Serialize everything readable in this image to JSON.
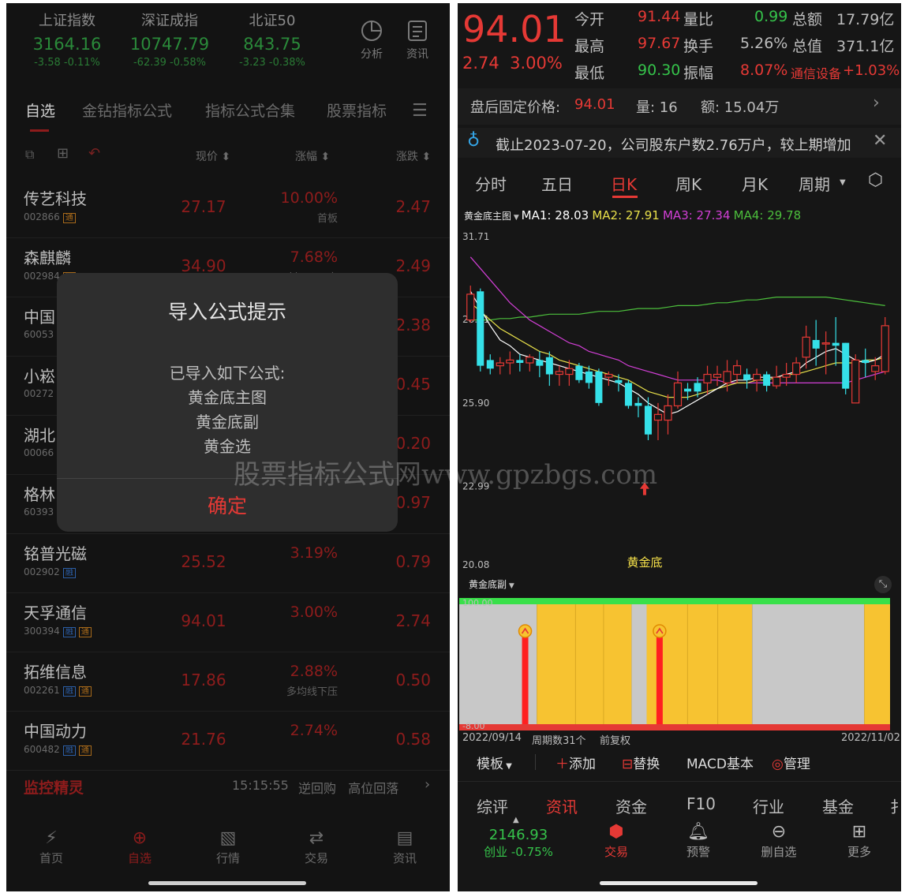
{
  "left": {
    "indices": [
      {
        "name": "上证指数",
        "value": "3164.16",
        "change": "-3.58  -0.11%"
      },
      {
        "name": "深证成指",
        "value": "10747.79",
        "change": "-62.39  -0.58%"
      },
      {
        "name": "北证50",
        "value": "843.75",
        "change": "-3.23  -0.38%"
      }
    ],
    "top_tools": [
      {
        "label": "分析",
        "icon": "pie-icon"
      },
      {
        "label": "资讯",
        "icon": "news-icon"
      }
    ],
    "tabs": [
      "自选",
      "金钻指标公式",
      "指标公式合集",
      "股票指标"
    ],
    "columns": {
      "price": "现价 ⬍",
      "pct": "涨幅 ⬍",
      "delta": "涨跌 ⬍"
    },
    "rows": [
      {
        "name": "传艺科技",
        "code": "002866",
        "badges": [
          "通"
        ],
        "price": "27.17",
        "pct": "10.00%",
        "tag": "首板",
        "delta": "2.47"
      },
      {
        "name": "森麒麟",
        "code": "002984",
        "badges": [
          "通"
        ],
        "price": "34.90",
        "pct": "7.68%",
        "tag": "创120天高",
        "delta": "2.49"
      },
      {
        "name": "中国",
        "code": "60053",
        "badges": [],
        "price": "",
        "pct": "",
        "tag": "",
        "delta": "2.38"
      },
      {
        "name": "小崧",
        "code": "00272",
        "badges": [],
        "price": "",
        "pct": "",
        "tag": "",
        "delta": "0.45"
      },
      {
        "name": "湖北",
        "code": "00066",
        "badges": [],
        "price": "",
        "pct": "",
        "tag": "",
        "delta": "0.20"
      },
      {
        "name": "格林",
        "code": "60393",
        "badges": [],
        "price": "",
        "pct": "",
        "tag": "",
        "delta": "0.97"
      },
      {
        "name": "铭普光磁",
        "code": "002902",
        "badges": [
          "融"
        ],
        "price": "25.52",
        "pct": "3.19%",
        "tag": "",
        "delta": "0.79"
      },
      {
        "name": "天孚通信",
        "code": "300394",
        "badges": [
          "融",
          "通"
        ],
        "price": "94.01",
        "pct": "3.00%",
        "tag": "",
        "delta": "2.74"
      },
      {
        "name": "拓维信息",
        "code": "002261",
        "badges": [
          "融",
          "通"
        ],
        "price": "17.86",
        "pct": "2.88%",
        "tag": "多均线下压",
        "delta": "0.50"
      },
      {
        "name": "中国动力",
        "code": "600482",
        "badges": [
          "融",
          "通"
        ],
        "price": "21.76",
        "pct": "2.74%",
        "tag": "",
        "delta": "0.58"
      }
    ],
    "dialog": {
      "title": "导入公式提示",
      "body": [
        "已导入如下公式:",
        "黄金底主图",
        "黄金底副",
        "黄金选"
      ],
      "ok": "确定"
    },
    "monitor": {
      "title": "监控精灵",
      "time": "15:15:55",
      "items": "逆回购   高位回落"
    },
    "bottom_nav": [
      {
        "label": "首页",
        "icon": "home-icon"
      },
      {
        "label": "自选",
        "icon": "watchlist-icon"
      },
      {
        "label": "行情",
        "icon": "market-icon"
      },
      {
        "label": "交易",
        "icon": "trade-icon"
      },
      {
        "label": "资讯",
        "icon": "news-icon"
      }
    ]
  },
  "right": {
    "price": "94.01",
    "change": "2.74  3.00%",
    "quote": {
      "today_open_label": "今开",
      "today_open": "91.44",
      "high_label": "最高",
      "high": "97.67",
      "low_label": "最低",
      "low": "90.30",
      "vol_ratio_label": "量比",
      "vol_ratio": "0.99",
      "turnover_label": "换手",
      "turnover": "5.26%",
      "amplitude_label": "振幅",
      "amplitude": "8.07%",
      "amount_label": "总额",
      "amount": "17.79亿",
      "mktcap_label": "总值",
      "mktcap": "371.1亿",
      "sector": "通信设备",
      "sector_change": "+1.03%"
    },
    "after_hours": {
      "label": "盘后固定价格:",
      "price": "94.01",
      "vol": "量: 16",
      "amt": "额: 15.04万"
    },
    "notice": "截止2023-07-20，公司股东户数2.76万户，较上期增加",
    "period_tabs": [
      "分时",
      "五日",
      "日K",
      "周K",
      "月K",
      "周期"
    ],
    "ma": {
      "indicator": "黄金底主图",
      "ma1": "MA1: 28.03",
      "ma2": "MA2: 27.91",
      "ma3": "MA3: 27.34",
      "ma4": "MA4: 29.78"
    },
    "colors": {
      "up": "#e53935",
      "down": "#35e0e8",
      "ma1": "#ffffff",
      "ma2": "#e8e04a",
      "ma3": "#d23fd6",
      "ma4": "#4cbf3c",
      "gold": "#f7c331"
    },
    "chart_data": {
      "type": "candlestick",
      "y_ticks": [
        "31.71",
        "28.81",
        "25.90",
        "22.99",
        "20.08"
      ],
      "ylim": [
        20.08,
        31.71
      ],
      "annotation": "黄金底",
      "candles": [
        {
          "o": 28.8,
          "c": 29.7,
          "h": 30.0,
          "l": 28.7
        },
        {
          "o": 29.8,
          "c": 27.2,
          "h": 29.9,
          "l": 27.0
        },
        {
          "o": 27.4,
          "c": 27.1,
          "h": 27.6,
          "l": 26.9
        },
        {
          "o": 27.2,
          "c": 27.3,
          "h": 27.5,
          "l": 26.9
        },
        {
          "o": 27.3,
          "c": 27.4,
          "h": 27.7,
          "l": 26.9
        },
        {
          "o": 27.4,
          "c": 27.3,
          "h": 27.6,
          "l": 27.0
        },
        {
          "o": 27.3,
          "c": 27.5,
          "h": 27.6,
          "l": 27.0
        },
        {
          "o": 27.4,
          "c": 27.2,
          "h": 27.7,
          "l": 26.8
        },
        {
          "o": 27.5,
          "c": 26.9,
          "h": 27.7,
          "l": 26.5
        },
        {
          "o": 26.9,
          "c": 27.0,
          "h": 27.2,
          "l": 26.5
        },
        {
          "o": 26.9,
          "c": 27.1,
          "h": 27.4,
          "l": 26.5
        },
        {
          "o": 27.2,
          "c": 26.7,
          "h": 27.3,
          "l": 26.6
        },
        {
          "o": 27.0,
          "c": 26.6,
          "h": 27.2,
          "l": 26.4
        },
        {
          "o": 27.0,
          "c": 25.9,
          "h": 27.1,
          "l": 25.8
        },
        {
          "o": 26.8,
          "c": 26.9,
          "h": 27.0,
          "l": 26.5
        },
        {
          "o": 26.7,
          "c": 26.6,
          "h": 26.9,
          "l": 26.3
        },
        {
          "o": 26.6,
          "c": 25.8,
          "h": 26.7,
          "l": 25.7
        },
        {
          "o": 25.9,
          "c": 25.8,
          "h": 26.1,
          "l": 25.4
        },
        {
          "o": 25.8,
          "c": 24.8,
          "h": 26.1,
          "l": 24.6
        },
        {
          "o": 25.3,
          "c": 25.5,
          "h": 25.9,
          "l": 24.6
        },
        {
          "o": 25.3,
          "c": 25.8,
          "h": 26.2,
          "l": 24.8
        },
        {
          "o": 25.8,
          "c": 26.6,
          "h": 27.0,
          "l": 25.7
        },
        {
          "o": 26.4,
          "c": 26.3,
          "h": 26.6,
          "l": 26.0
        },
        {
          "o": 26.6,
          "c": 26.3,
          "h": 26.8,
          "l": 26.1
        },
        {
          "o": 26.6,
          "c": 26.9,
          "h": 27.2,
          "l": 26.2
        },
        {
          "o": 26.8,
          "c": 26.9,
          "h": 27.2,
          "l": 26.5
        },
        {
          "o": 26.6,
          "c": 27.0,
          "h": 27.4,
          "l": 26.3
        },
        {
          "o": 26.9,
          "c": 27.2,
          "h": 27.4,
          "l": 26.6
        },
        {
          "o": 26.9,
          "c": 26.7,
          "h": 27.1,
          "l": 26.4
        },
        {
          "o": 26.7,
          "c": 26.9,
          "h": 27.1,
          "l": 26.3
        },
        {
          "o": 26.9,
          "c": 26.5,
          "h": 27.0,
          "l": 26.3
        },
        {
          "o": 26.5,
          "c": 26.8,
          "h": 27.2,
          "l": 26.4
        },
        {
          "o": 26.8,
          "c": 26.9,
          "h": 27.3,
          "l": 26.5
        },
        {
          "o": 26.9,
          "c": 27.3,
          "h": 27.5,
          "l": 26.6
        },
        {
          "o": 27.5,
          "c": 28.2,
          "h": 28.6,
          "l": 27.1
        },
        {
          "o": 28.1,
          "c": 27.8,
          "h": 28.8,
          "l": 27.2
        },
        {
          "o": 28.0,
          "c": 28.0,
          "h": 28.4,
          "l": 26.9
        },
        {
          "o": 28.0,
          "c": 27.9,
          "h": 28.9,
          "l": 27.2
        },
        {
          "o": 28.0,
          "c": 26.4,
          "h": 28.0,
          "l": 26.2
        },
        {
          "o": 25.9,
          "c": 27.4,
          "h": 27.6,
          "l": 25.9
        },
        {
          "o": 27.4,
          "c": 27.3,
          "h": 27.8,
          "l": 26.8
        },
        {
          "o": 27.0,
          "c": 27.2,
          "h": 27.5,
          "l": 26.7
        },
        {
          "o": 27.0,
          "c": 28.6,
          "h": 28.9,
          "l": 26.9
        }
      ],
      "ma_lines": {
        "ma1": [
          29.8,
          29.2,
          28.6,
          28.1,
          27.9,
          27.6,
          27.5,
          27.4,
          27.3,
          27.2,
          27.1,
          27.0,
          26.9,
          26.8,
          26.7,
          26.6,
          26.4,
          26.2,
          25.9,
          25.7,
          25.5,
          25.6,
          25.8,
          26.0,
          26.2,
          26.4,
          26.6,
          26.7,
          26.7,
          26.8,
          26.8,
          26.8,
          26.9,
          27.0,
          27.3,
          27.5,
          27.7,
          27.8,
          27.6,
          27.4,
          27.3,
          27.4,
          27.6
        ],
        "ma2": [
          29.4,
          29.1,
          28.8,
          28.5,
          28.3,
          28.1,
          27.9,
          27.7,
          27.6,
          27.4,
          27.3,
          27.2,
          27.1,
          27.0,
          26.9,
          26.8,
          26.7,
          26.5,
          26.3,
          26.2,
          26.1,
          26.1,
          26.1,
          26.2,
          26.3,
          26.4,
          26.5,
          26.6,
          26.6,
          26.7,
          26.7,
          26.8,
          26.9,
          26.9,
          27.0,
          27.1,
          27.2,
          27.3,
          27.3,
          27.3,
          27.4,
          27.4,
          27.5
        ],
        "ma3": [
          31.0,
          30.6,
          30.2,
          29.8,
          29.4,
          29.1,
          28.8,
          28.6,
          28.4,
          28.2,
          28.0,
          27.9,
          27.7,
          27.6,
          27.5,
          27.4,
          27.2,
          27.1,
          27.0,
          26.9,
          26.8,
          26.7,
          26.7,
          26.7,
          26.7,
          26.7,
          26.6,
          26.6,
          26.6,
          26.6,
          26.6,
          26.6,
          26.6,
          26.6,
          26.6,
          26.6,
          26.6,
          26.6,
          26.6,
          26.7,
          26.8,
          26.9,
          27.0
        ],
        "ma4": [
          28.8,
          28.8,
          28.8,
          28.85,
          28.85,
          28.9,
          28.9,
          28.95,
          29.0,
          29.0,
          29.0,
          29.0,
          29.05,
          29.1,
          29.1,
          29.1,
          29.15,
          29.2,
          29.2,
          29.2,
          29.25,
          29.3,
          29.3,
          29.3,
          29.35,
          29.4,
          29.4,
          29.45,
          29.5,
          29.5,
          29.55,
          29.6,
          29.6,
          29.6,
          29.6,
          29.6,
          29.6,
          29.55,
          29.5,
          29.45,
          29.4,
          29.35,
          29.3
        ]
      },
      "signal_arrow_index": 17,
      "sub": {
        "indicator": "黄金底副",
        "ylim": [
          -8.0,
          100.0
        ],
        "segments": [
          {
            "from": 0,
            "to": 0.18,
            "color": "#c8c8c8"
          },
          {
            "from": 0.18,
            "to": 0.4,
            "color": "#f7c331"
          },
          {
            "from": 0.4,
            "to": 0.435,
            "color": "#c8c8c8"
          },
          {
            "from": 0.435,
            "to": 0.68,
            "color": "#f7c331"
          },
          {
            "from": 0.68,
            "to": 0.94,
            "color": "#c8c8c8"
          },
          {
            "from": 0.94,
            "to": 1.0,
            "color": "#f7c331"
          }
        ],
        "spikes": [
          0.153,
          0.465
        ],
        "start_date": "2022/09/14",
        "cycle": "周期数31个",
        "adjust": "前复权",
        "end_date": "2022/11/02"
      }
    },
    "toolbar": {
      "template": "模板",
      "add": "添加",
      "replace": "替换",
      "macd": "MACD基本",
      "manage": "管理"
    },
    "bottom_tabs": [
      "综评",
      "资讯",
      "资金",
      "F10",
      "行业",
      "基金",
      "扌"
    ],
    "bottom_nav": [
      {
        "label": "2146.93",
        "sub": "创业 -0.75%",
        "icon": "index-quote"
      },
      {
        "label": "交易",
        "icon": "trade-icon"
      },
      {
        "label": "预警",
        "icon": "bell-icon"
      },
      {
        "label": "删自选",
        "icon": "remove-icon"
      },
      {
        "label": "更多",
        "icon": "grid-icon"
      }
    ]
  },
  "watermark": "股票指标公式网www.gpzbgs.com"
}
